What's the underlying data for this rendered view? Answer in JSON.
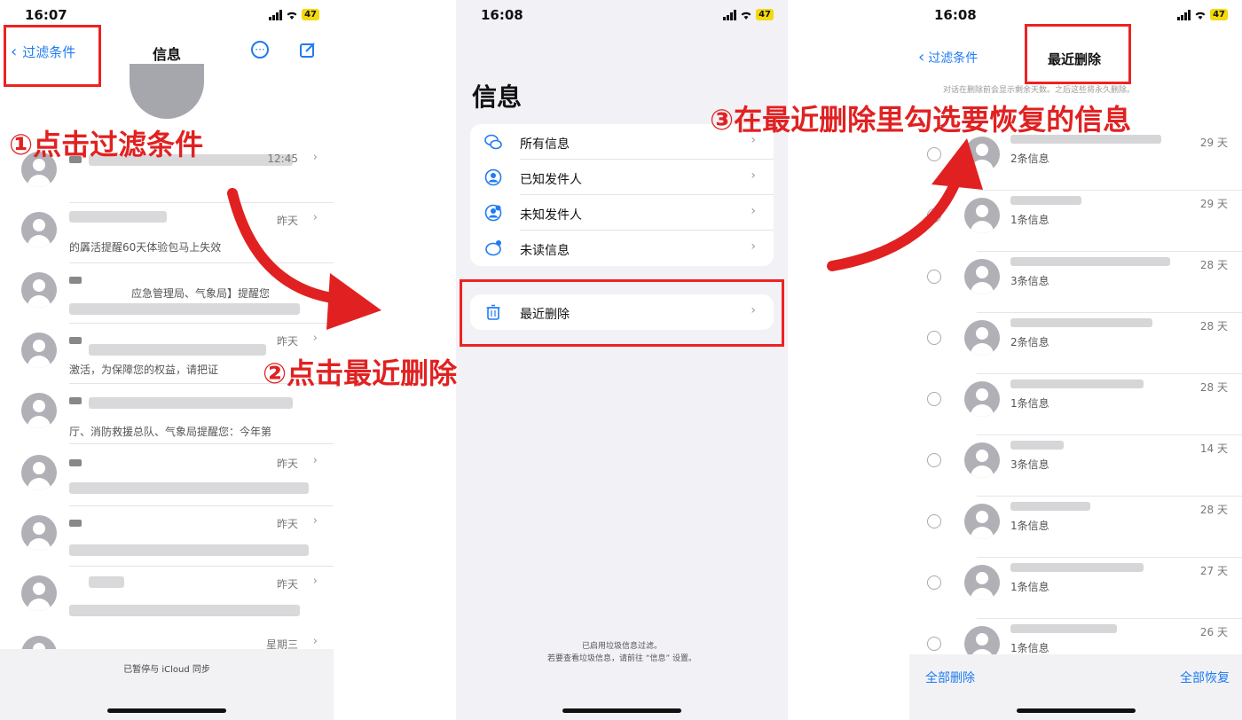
{
  "panel1": {
    "time": "16:07",
    "battery": "47",
    "back_label": "过滤条件",
    "title": "信息",
    "conversations": [
      {
        "date": "12:45",
        "text": ""
      },
      {
        "date": "昨天",
        "text": "的羼活提醒60天体验包马上失效"
      },
      {
        "date": "",
        "text": "应急管理局、气象局】提醒您"
      },
      {
        "date": "昨天",
        "text": "激活，为保障您的权益，请把证"
      },
      {
        "date": "",
        "text": "厅、消防救援总队、气象局提醒您：今年第"
      },
      {
        "date": "昨天",
        "text": ""
      },
      {
        "date": "昨天",
        "text": ""
      },
      {
        "date": "昨天",
        "text": ""
      },
      {
        "date": "星期三",
        "text": ""
      }
    ],
    "bottom_text": "已暂停与 iCloud 同步"
  },
  "panel2": {
    "time": "16:08",
    "battery": "47",
    "large_title": "信息",
    "filters": [
      "所有信息",
      "已知发件人",
      "未知发件人",
      "未读信息"
    ],
    "recently_deleted": "最近删除",
    "footer_line1": "已启用垃圾信息过滤。",
    "footer_line2": "若要查看垃圾信息，请前往 “信息” 设置。"
  },
  "panel3": {
    "time": "16:08",
    "battery": "47",
    "back_label": "过滤条件",
    "title": "最近删除",
    "note": "对话在删除前会显示剩余天数。之后这些将永久删除。",
    "items": [
      {
        "days": "29 天",
        "count": "2条信息"
      },
      {
        "days": "29 天",
        "count": "1条信息"
      },
      {
        "days": "28 天",
        "count": "3条信息"
      },
      {
        "days": "28 天",
        "count": "2条信息"
      },
      {
        "days": "28 天",
        "count": "1条信息"
      },
      {
        "days": "14 天",
        "count": "3条信息"
      },
      {
        "days": "28 天",
        "count": "1条信息"
      },
      {
        "days": "27 天",
        "count": "1条信息"
      },
      {
        "days": "26 天",
        "count": "1条信息"
      }
    ],
    "delete_all": "全部删除",
    "recover_all": "全部恢复"
  },
  "callouts": {
    "step1": "①点击过滤条件",
    "step2": "②点击最近删除",
    "step3": "③在最近删除里勾选要恢复的信息"
  },
  "colors": {
    "accent": "#1f7bf2",
    "annotation": "#e12121"
  }
}
